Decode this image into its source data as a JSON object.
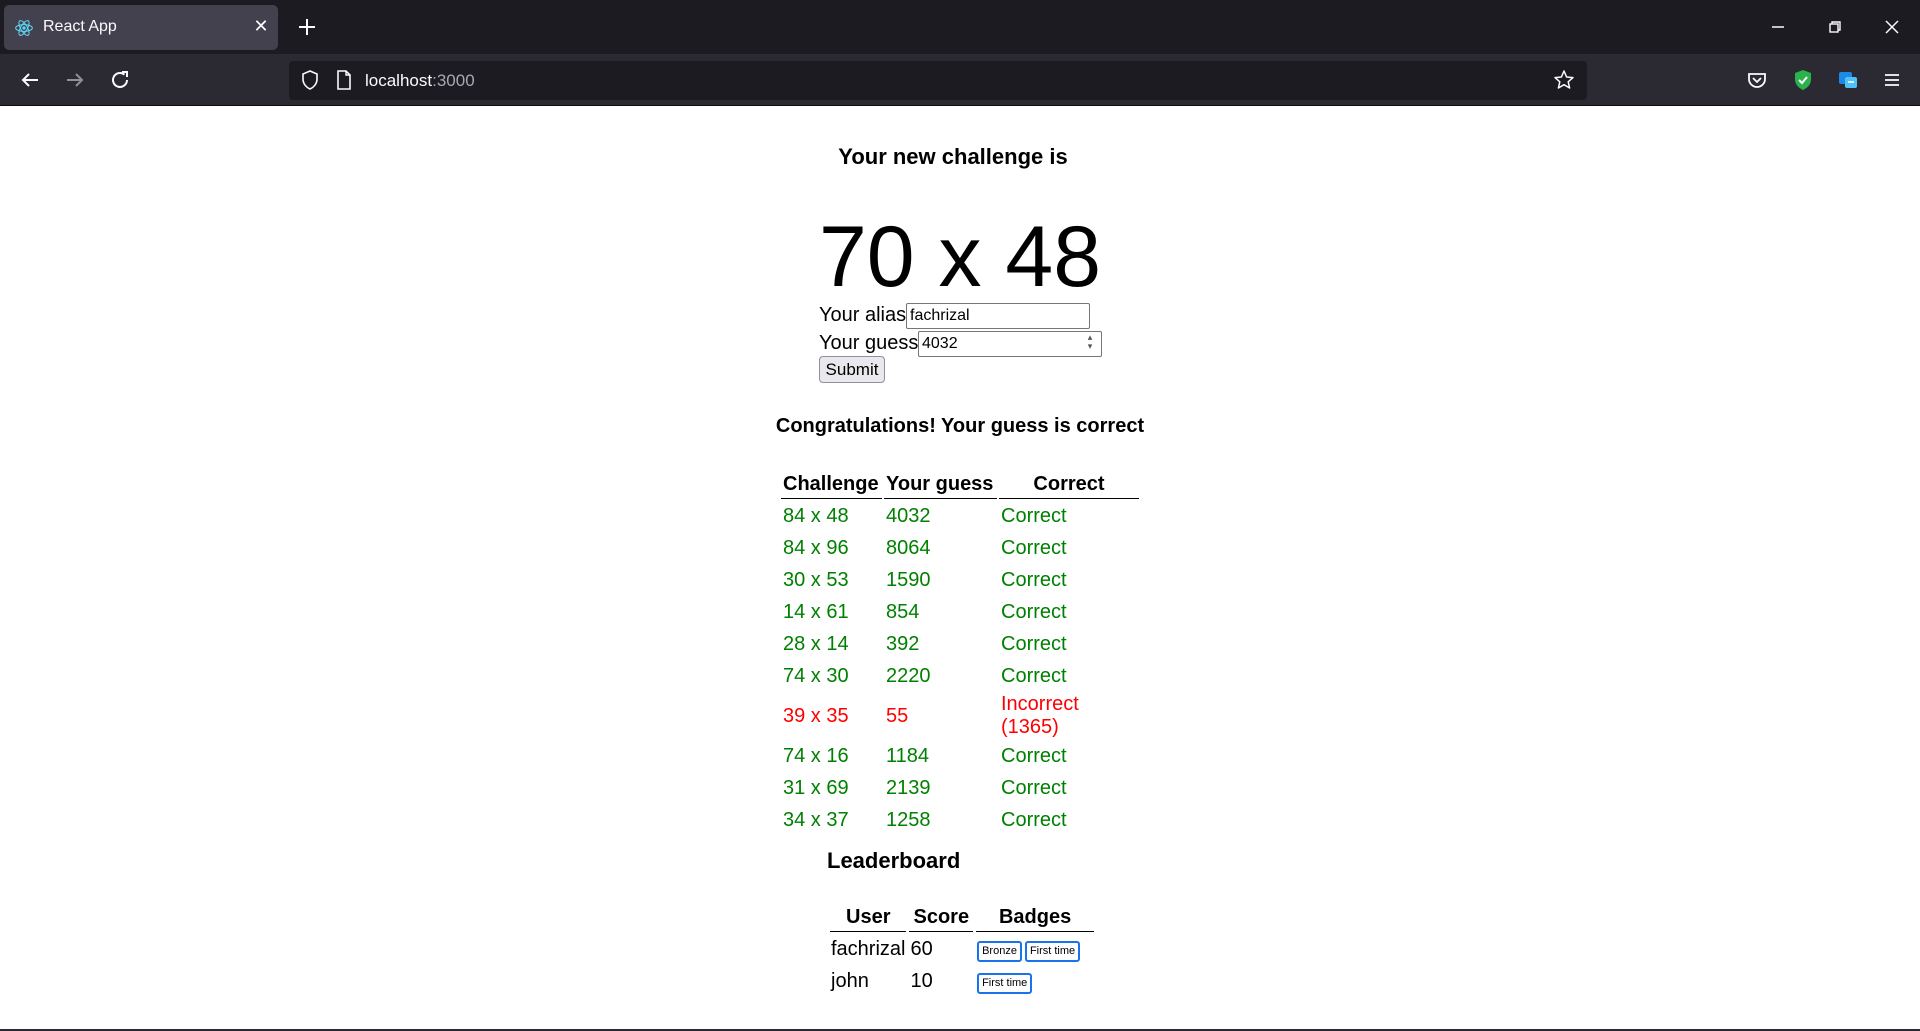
{
  "browser": {
    "tab_title": "React App",
    "url_host": "localhost",
    "url_port": ":3000"
  },
  "page": {
    "heading": "Your new challenge is",
    "challenge": "70 x 48",
    "alias_label": "Your alias:",
    "alias_value": "fachrizal",
    "guess_label": "Your guess:",
    "guess_value": "4032",
    "submit_label": "Submit",
    "result_message": "Congratulations! Your guess is correct"
  },
  "attempts": {
    "headers": [
      "Challenge",
      "Your guess",
      "Correct"
    ],
    "rows": [
      {
        "challenge": "84 x 48",
        "guess": "4032",
        "result": "Correct",
        "status": "correct"
      },
      {
        "challenge": "84 x 96",
        "guess": "8064",
        "result": "Correct",
        "status": "correct"
      },
      {
        "challenge": "30 x 53",
        "guess": "1590",
        "result": "Correct",
        "status": "correct"
      },
      {
        "challenge": "14 x 61",
        "guess": "854",
        "result": "Correct",
        "status": "correct"
      },
      {
        "challenge": "28 x 14",
        "guess": "392",
        "result": "Correct",
        "status": "correct"
      },
      {
        "challenge": "74 x 30",
        "guess": "2220",
        "result": "Correct",
        "status": "correct"
      },
      {
        "challenge": "39 x 35",
        "guess": "55",
        "result": "Incorrect (1365)",
        "status": "incorrect"
      },
      {
        "challenge": "74 x 16",
        "guess": "1184",
        "result": "Correct",
        "status": "correct"
      },
      {
        "challenge": "31 x 69",
        "guess": "2139",
        "result": "Correct",
        "status": "correct"
      },
      {
        "challenge": "34 x 37",
        "guess": "1258",
        "result": "Correct",
        "status": "correct"
      }
    ]
  },
  "leaderboard": {
    "title": "Leaderboard",
    "headers": [
      "User",
      "Score",
      "Badges"
    ],
    "rows": [
      {
        "user": "fachrizal",
        "score": "60",
        "badges": [
          "Bronze",
          "First time"
        ]
      },
      {
        "user": "john",
        "score": "10",
        "badges": [
          "First time"
        ]
      }
    ]
  },
  "colors": {
    "correct": "#008000",
    "incorrect": "#ff0000",
    "badge_border": "#1a73e8",
    "chrome_dark": "#1c1b22",
    "chrome_toolbar": "#2b2a33"
  }
}
